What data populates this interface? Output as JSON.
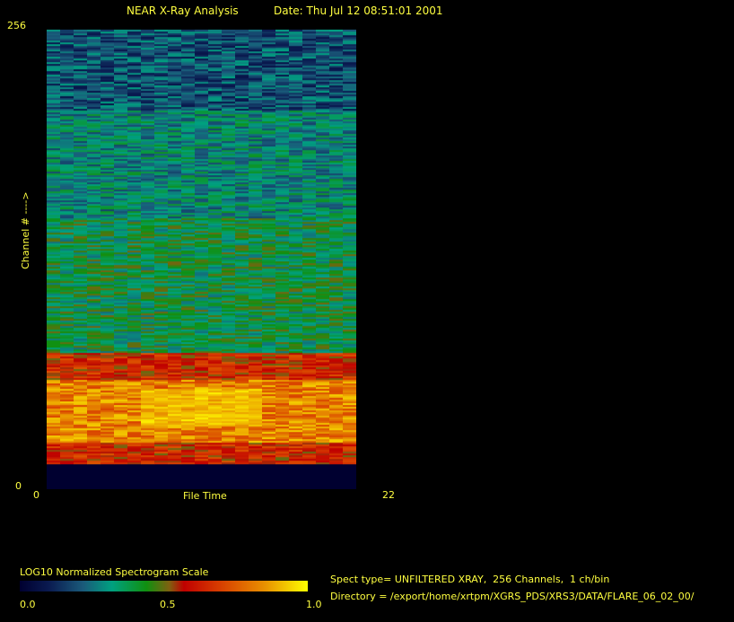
{
  "header": {
    "title": "NEAR X-Ray Analysis",
    "date": "Date: Thu Jul 12 08:51:01 2001"
  },
  "chart_data": {
    "type": "heatmap",
    "title": "NEAR X-Ray Analysis",
    "xlabel": "File Time",
    "ylabel": "Channel # ---->",
    "xlim": [
      0,
      22
    ],
    "ylim": [
      0,
      256
    ],
    "x_tick_labels": [
      "0",
      "22"
    ],
    "y_tick_labels": [
      "0",
      "256"
    ],
    "columns": 23,
    "channels_per_bin": 1,
    "value_scale": "LOG10 normalized 0-1",
    "channel_profile": [
      {
        "channels": [
          0,
          13
        ],
        "mean": 0.03,
        "spread": 0.0
      },
      {
        "channels": [
          14,
          25
        ],
        "mean": 0.62,
        "spread": 0.12
      },
      {
        "channels": [
          26,
          60
        ],
        "mean": 0.82,
        "spread": 0.12
      },
      {
        "channels": [
          61,
          75
        ],
        "mean": 0.62,
        "spread": 0.12
      },
      {
        "channels": [
          76,
          150
        ],
        "mean": 0.38,
        "spread": 0.13
      },
      {
        "channels": [
          151,
          210
        ],
        "mean": 0.3,
        "spread": 0.12
      },
      {
        "channels": [
          211,
          256
        ],
        "mean": 0.2,
        "spread": 0.12
      }
    ],
    "peak": {
      "columns": [
        7,
        15
      ],
      "channels": [
        35,
        55
      ],
      "value": 0.97
    }
  },
  "colorbar": {
    "label": "LOG10 Normalized Spectrogram Scale",
    "ticks": [
      "0.0",
      "0.5",
      "1.0"
    ]
  },
  "info": {
    "spect_type": "Spect type= UNFILTERED XRAY,  256 Channels,  1 ch/bin",
    "directory": "Directory = /export/home/xrtpm/XGRS_PDS/XRS3/DATA/FLARE_06_02_00/"
  }
}
